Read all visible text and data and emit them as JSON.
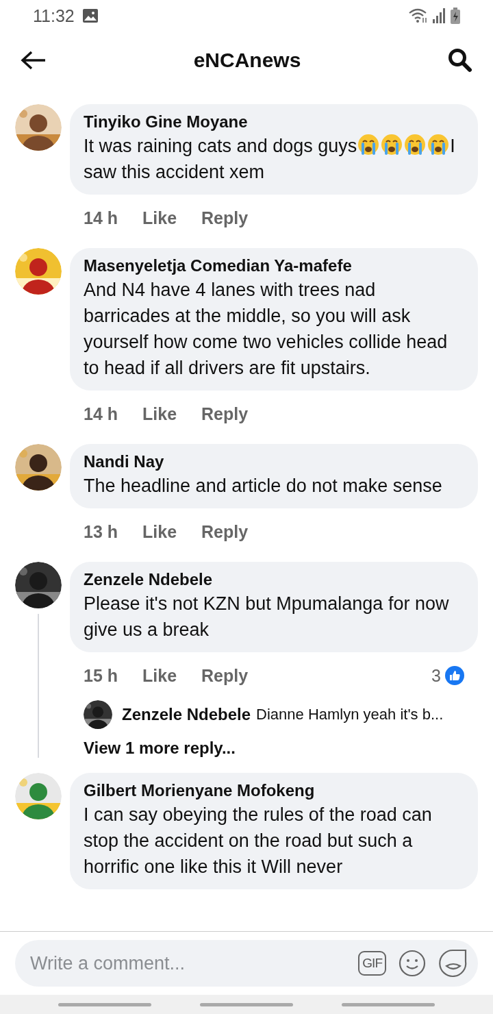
{
  "status_bar": {
    "time": "11:32"
  },
  "header": {
    "title": "eNCAnews"
  },
  "comments": [
    {
      "author": "Tinyiko Gine Moyane",
      "body": [
        {
          "kind": "text",
          "text": "It was raining cats and dogs guys"
        },
        {
          "kind": "emoji"
        },
        {
          "kind": "emoji"
        },
        {
          "kind": "emoji"
        },
        {
          "kind": "emoji"
        },
        {
          "kind": "text",
          "text": "I saw this accident xem"
        }
      ],
      "time": "14 h",
      "like": "Like",
      "reply": "Reply"
    },
    {
      "author": "Masenyeletja Comedian Ya-mafefe",
      "body": [
        {
          "kind": "text",
          "text": "And N4 have 4 lanes with trees nad barricades at the middle, so you will ask yourself how come two vehicles collide head to head if all drivers are fit upstairs."
        }
      ],
      "time": "14 h",
      "like": "Like",
      "reply": "Reply"
    },
    {
      "author": "Nandi Nay",
      "body": [
        {
          "kind": "text",
          "text": "The headline and article do not make sense"
        }
      ],
      "time": "13 h",
      "like": "Like",
      "reply": "Reply"
    },
    {
      "author": "Zenzele Ndebele",
      "body": [
        {
          "kind": "text",
          "text": "Please it's not KZN but Mpumalanga for now give us a break"
        }
      ],
      "time": "15 h",
      "like": "Like",
      "reply": "Reply",
      "reaction_count": "3",
      "replies": [
        {
          "author": "Zenzele Ndebele",
          "text": "Dianne Hamlyn yeah it's b..."
        }
      ],
      "more_replies": "View 1 more reply..."
    },
    {
      "author": "Gilbert Morienyane Mofokeng",
      "body": [
        {
          "kind": "text",
          "text": "I can say obeying the rules of the road can stop the accident on the road but such a horrific one like this it Will never"
        }
      ]
    }
  ],
  "composer": {
    "placeholder": "Write a comment...",
    "gif": "GIF"
  }
}
